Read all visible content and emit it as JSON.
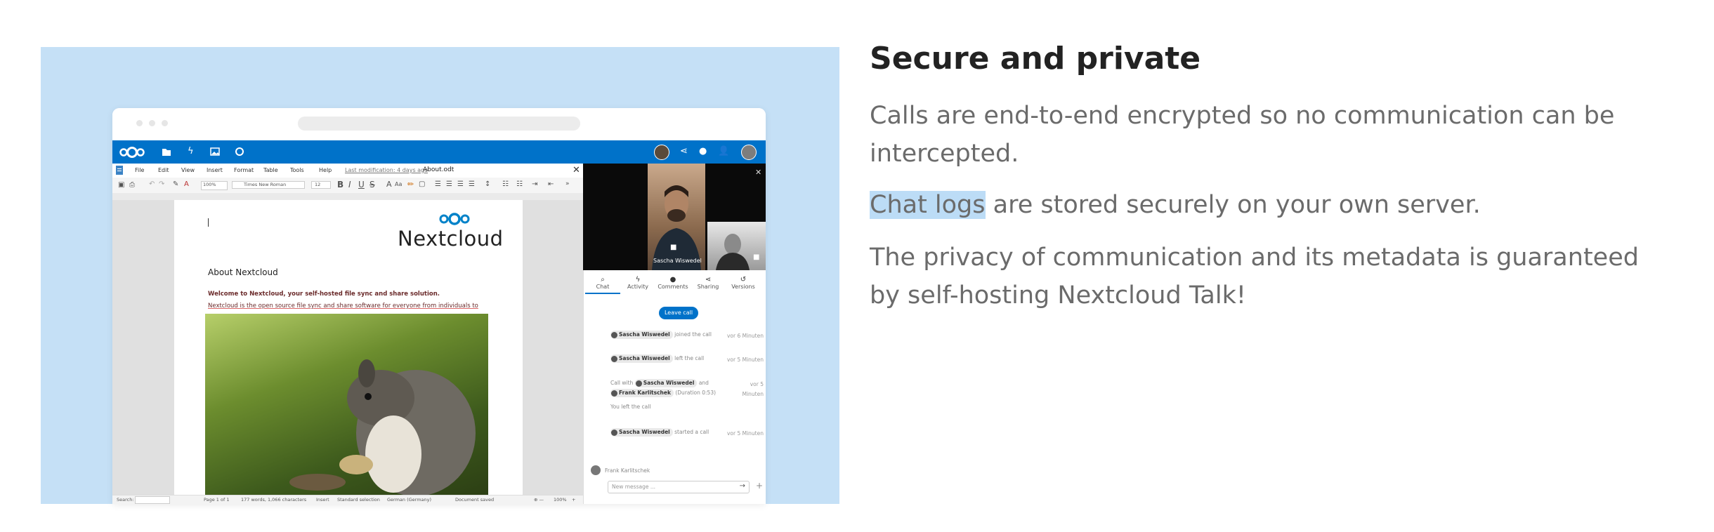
{
  "section": {
    "heading": "Secure and private",
    "para1": "Calls are end-to-end encrypted so no communication can be intercepted.",
    "para2_highlight": "Chat logs",
    "para2_rest": " are stored securely on your own server.",
    "para3": "The privacy of communication and its metadata is guaranteed by self-hosting Nextcloud Talk!"
  },
  "editor": {
    "menu": [
      "File",
      "Edit",
      "View",
      "Insert",
      "Format",
      "Table",
      "Tools",
      "Help"
    ],
    "last_modification": "Last modification: 4 days ago",
    "filename": "About.odt",
    "zoom": "100%",
    "font_name": "Times New Roman",
    "font_size": "12",
    "doc_logo_text": "Nextcloud",
    "doc_heading": "About Nextcloud",
    "doc_bold_line": "Welcome to Nextcloud, your self-hosted file sync and share solution.",
    "doc_line2": "Nextcloud is the open source file sync and share software for everyone from individuals to",
    "status": {
      "search_label": "Search:",
      "page": "Page 1 of 1",
      "words": "177 words, 1,066 characters",
      "insert": "Insert",
      "selection": "Standard selection",
      "language": "German (Germany)",
      "saved": "Document saved",
      "zoom": "100%"
    }
  },
  "talk": {
    "caller_name": "Sascha Wiswedel",
    "tabs": [
      {
        "icon": "search-icon",
        "label": "Chat"
      },
      {
        "icon": "activity-icon",
        "label": "Activity"
      },
      {
        "icon": "comment-icon",
        "label": "Comments"
      },
      {
        "icon": "share-icon",
        "label": "Sharing"
      },
      {
        "icon": "history-icon",
        "label": "Versions"
      }
    ],
    "leave_call": "Leave call",
    "messages": [
      {
        "user": "Sascha Wiswedel",
        "text": "joined the call",
        "time": "vor 6 Minuten"
      },
      {
        "user": "Sascha Wiswedel",
        "text": "left the call",
        "time": "vor 5 Minuten"
      }
    ],
    "call_summary": {
      "prefix": "Call with",
      "user1": "Sascha Wiswedel",
      "and": "and",
      "user2": "Frank Karlitschek",
      "duration": "(Duration 0:53)",
      "time1": "vor 5",
      "time2": "Minuten"
    },
    "you_left": "You left the call",
    "started": {
      "user": "Sascha Wiswedel",
      "text": "started a call",
      "time": "vor 5 Minuten"
    },
    "current_user": "Frank Karlitschek",
    "input_placeholder": "New message ..."
  },
  "colors": {
    "panel_bg": "#c5e0f6",
    "nextcloud_blue": "#0072c9",
    "highlight": "#bcdcf6",
    "heading": "#222222",
    "body_text": "#6b6b6b"
  }
}
